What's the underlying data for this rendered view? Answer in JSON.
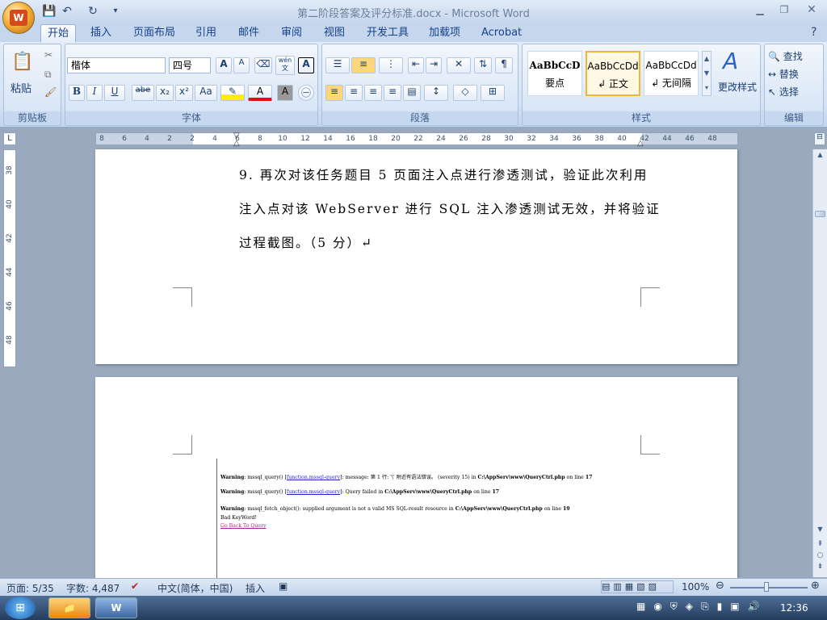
{
  "window": {
    "title": "第二阶段答案及评分标准.docx - Microsoft Word"
  },
  "tabs": [
    "开始",
    "插入",
    "页面布局",
    "引用",
    "邮件",
    "审阅",
    "视图",
    "开发工具",
    "加载项",
    "Acrobat"
  ],
  "ribbon": {
    "clipboard": {
      "label": "剪贴板",
      "paste": "粘贴"
    },
    "font": {
      "label": "字体",
      "family": "楷体",
      "size": "四号",
      "bold": "B",
      "italic": "I",
      "underline": "U",
      "strike": "abe",
      "sub": "x₂",
      "sup": "x²",
      "case": "Aa",
      "grow": "A",
      "shrink": "A",
      "wen": "wén",
      "wen_char": "文",
      "abox": "A"
    },
    "paragraph": {
      "label": "段落"
    },
    "styles": {
      "label": "样式",
      "items": [
        {
          "sample": "AaBbCcD",
          "name": "要点"
        },
        {
          "sample": "AaBbCcDd",
          "name": "↲ 正文"
        },
        {
          "sample": "AaBbCcDd",
          "name": "↲ 无间隔"
        }
      ],
      "change": "更改样式"
    },
    "editing": {
      "label": "编辑",
      "find": "查找",
      "replace": "替换",
      "select": "选择"
    }
  },
  "ruler": {
    "ticks": [
      "8",
      "6",
      "4",
      "2",
      "2",
      "4",
      "6",
      "8",
      "10",
      "12",
      "14",
      "16",
      "18",
      "20",
      "22",
      "24",
      "26",
      "28",
      "30",
      "32",
      "34",
      "36",
      "38",
      "40",
      "42",
      "44",
      "46",
      "48"
    ]
  },
  "vruler": {
    "ticks": [
      "38",
      "40",
      "42",
      "44",
      "46",
      "48"
    ]
  },
  "document": {
    "line1": "9.  再次对该任务题目 5 页面注入点进行渗透测试，验证此次利用",
    "line2": "注入点对该 WebServer 进行 SQL 注入渗透测试无效，并将验证",
    "line3": "过程截图。（5 分）↵",
    "screenshot": {
      "w1a": "Warning",
      "w1b": ": mssql_query() [",
      "w1link": "function.mssql-query",
      "w1c": "]: message: 第 1 行: '\\' 附近有语法错误。 (severity 15) in ",
      "w1path": "C:\\AppServ\\www\\QueryCtrl.php",
      "w1d": " on line ",
      "w1line": "17",
      "w2b": ": mssql_query() [",
      "w2link": "function.mssql-query",
      "w2c": "]: Query failed in ",
      "w2path": "C:\\AppServ\\www\\QueryCtrl.php",
      "w2d": " on line ",
      "w2line": "17",
      "w3b": ": mssql_fetch_object(): supplied argument is not a valid MS SQL-result resource in ",
      "w3path": "C:\\AppServ\\www\\QueryCtrl.php",
      "w3d": " on line ",
      "w3line": "19",
      "bad": "Bad KeyWord!",
      "back": "Go Back To Query"
    }
  },
  "status": {
    "page": "页面: 5/35",
    "words": "字数: 4,487",
    "lang": "中文(简体，中国)",
    "mode": "插入",
    "zoom": "100%"
  },
  "taskbar": {
    "time": "12:36"
  }
}
